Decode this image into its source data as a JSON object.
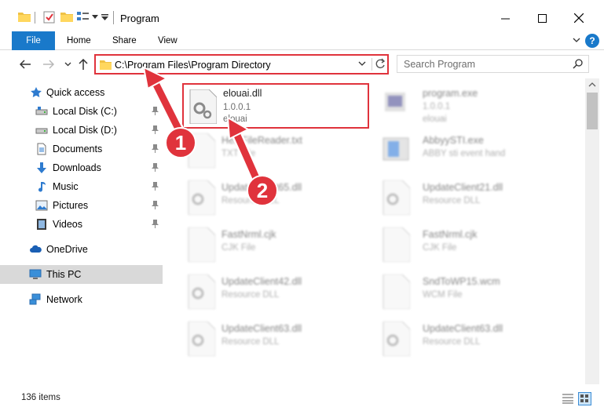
{
  "window": {
    "title": "Program",
    "minimize_glyph": "—",
    "maximize_glyph": "☐",
    "close_glyph": "✕"
  },
  "ribbon": {
    "tabs": [
      "File",
      "Home",
      "Share",
      "View"
    ],
    "help_glyph": "?"
  },
  "address": {
    "path": "C:\\Program Files\\Program Directory",
    "search_placeholder": "Search Program"
  },
  "nav": {
    "items": [
      {
        "label": "Quick access",
        "icon": "star-icon"
      },
      {
        "label": "Local Disk (C:)",
        "icon": "drive-icon",
        "pinned": true
      },
      {
        "label": "Local Disk (D:)",
        "icon": "drive-icon",
        "pinned": true
      },
      {
        "label": "Documents",
        "icon": "documents-icon",
        "pinned": true
      },
      {
        "label": "Downloads",
        "icon": "download-icon",
        "pinned": true
      },
      {
        "label": "Music",
        "icon": "music-icon",
        "pinned": true
      },
      {
        "label": "Pictures",
        "icon": "pictures-icon",
        "pinned": true
      },
      {
        "label": "Videos",
        "icon": "videos-icon",
        "pinned": true
      },
      {
        "label": "OneDrive",
        "icon": "cloud-icon"
      },
      {
        "label": "This PC",
        "icon": "computer-icon",
        "selected": true
      },
      {
        "label": "Network",
        "icon": "network-icon"
      }
    ]
  },
  "files": [
    {
      "name": "elouai.dll",
      "line1": "1.0.0.1",
      "line2": "elouai",
      "icon": "dll-gear-icon",
      "highlighted": true
    },
    {
      "name": "program.exe",
      "line1": "1.0.0.1",
      "line2": "elouai",
      "icon": "exe-icon"
    },
    {
      "name": "HelpFileReader.txt",
      "line1": "TXT File",
      "line2": "",
      "icon": "text-file-icon"
    },
    {
      "name": "AbbyySTI.exe",
      "line1": "ABBY sti event hand",
      "line2": "",
      "icon": "exe-icon"
    },
    {
      "name": "UpdateClient65.dll",
      "line1": "Resource DLL",
      "line2": "",
      "icon": "dll-gear-icon"
    },
    {
      "name": "UpdateClient21.dll",
      "line1": "Resource DLL",
      "line2": "",
      "icon": "dll-gear-icon"
    },
    {
      "name": "FastNrml.cjk",
      "line1": "CJK File",
      "line2": "",
      "icon": "blank-file-icon"
    },
    {
      "name": "FastNrml.cjk",
      "line1": "CJK File",
      "line2": "",
      "icon": "blank-file-icon"
    },
    {
      "name": "UpdateClient42.dll",
      "line1": "Resource DLL",
      "line2": "",
      "icon": "dll-gear-icon"
    },
    {
      "name": "SndToWP15.wcm",
      "line1": "WCM File",
      "line2": "",
      "icon": "blank-file-icon"
    },
    {
      "name": "UpdateClient63.dll",
      "line1": "Resource DLL",
      "line2": "",
      "icon": "dll-gear-icon"
    },
    {
      "name": "UpdateClient63.dll",
      "line1": "Resource DLL",
      "line2": "",
      "icon": "dll-gear-icon"
    }
  ],
  "status": {
    "item_count": "136 items"
  },
  "annotations": [
    {
      "label": "1",
      "color": "#e0333c"
    },
    {
      "label": "2",
      "color": "#e0333c"
    }
  ]
}
